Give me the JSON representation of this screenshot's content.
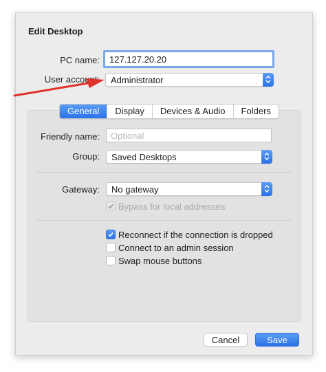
{
  "dialog": {
    "title": "Edit Desktop"
  },
  "pc_name": {
    "label": "PC name:",
    "value": "127.127.20.20"
  },
  "user_account": {
    "label": "User account:",
    "value": "Administrator"
  },
  "tabs": [
    {
      "label": "General",
      "active": true
    },
    {
      "label": "Display",
      "active": false
    },
    {
      "label": "Devices & Audio",
      "active": false
    },
    {
      "label": "Folders",
      "active": false
    }
  ],
  "general": {
    "friendly_name": {
      "label": "Friendly name:",
      "value": "",
      "placeholder": "Optional"
    },
    "group": {
      "label": "Group:",
      "value": "Saved Desktops"
    },
    "gateway": {
      "label": "Gateway:",
      "value": "No gateway"
    },
    "bypass": {
      "label": "Bypass for local addresses",
      "checked": true,
      "enabled": false
    },
    "options": [
      {
        "label": "Reconnect if the connection is dropped",
        "checked": true
      },
      {
        "label": "Connect to an admin session",
        "checked": false
      },
      {
        "label": "Swap mouse buttons",
        "checked": false
      }
    ]
  },
  "buttons": {
    "cancel": "Cancel",
    "save": "Save"
  },
  "colors": {
    "accent": "#2a72e8",
    "annotation_arrow": "#e0302a"
  },
  "icons": {
    "popup_indicator": "chevron-up-down-icon",
    "checkmark": "checkmark-icon",
    "annotation": "red-arrow-icon"
  }
}
